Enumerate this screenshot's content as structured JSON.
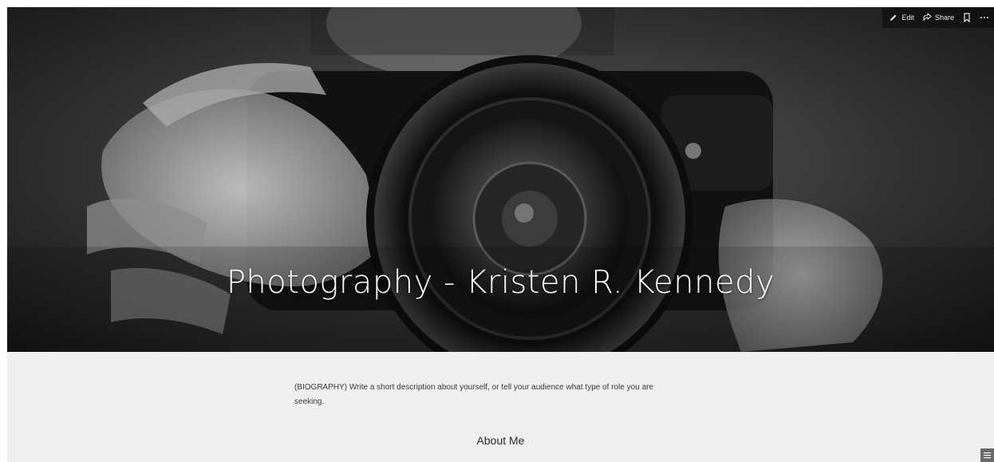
{
  "hero": {
    "title": "Photography - Kristen R. Kennedy"
  },
  "toolbar": {
    "edit_label": "Edit",
    "share_label": "Share",
    "save_icon": "bookmark-icon",
    "more_icon": "more-horizontal-icon"
  },
  "content": {
    "bio_text": "(BIOGRAPHY) Write a short description about yourself, or tell your audience what type of role you are seeking.",
    "about_heading": "About Me"
  },
  "corner": {
    "icon": "menu-lines-icon"
  },
  "colors": {
    "content_bg": "#efefef",
    "hero_overlay": "#2a2a2a",
    "title_text": "#ffffff"
  }
}
